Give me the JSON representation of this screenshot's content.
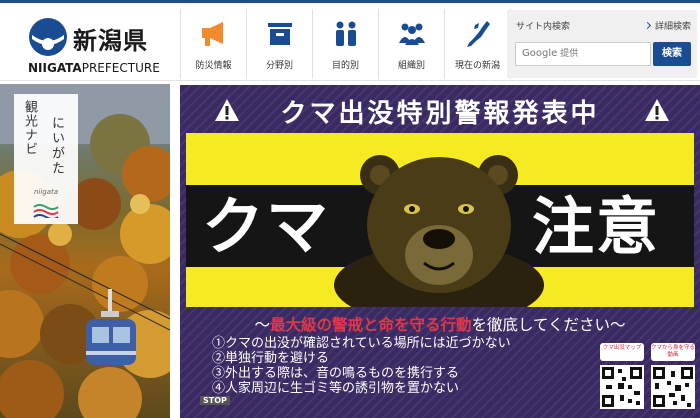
{
  "header": {
    "logo": {
      "name_ja": "新潟県",
      "name_en_bold": "NIIGATA",
      "name_en_light": "PREFECTURE"
    },
    "nav": [
      {
        "label": "防災情報",
        "icon": "megaphone-icon",
        "color": "#f1892d"
      },
      {
        "label": "分野別",
        "icon": "box-icon",
        "color": "#1a4c93"
      },
      {
        "label": "目的別",
        "icon": "people-icon",
        "color": "#1a4c93"
      },
      {
        "label": "組織別",
        "icon": "group-icon",
        "color": "#1a4c93"
      },
      {
        "label": "現在の新潟",
        "icon": "niigata-map-icon",
        "color": "#1a4c93"
      }
    ],
    "search": {
      "title": "サイト内検索",
      "advanced_label": "詳細検索",
      "placeholder_brand": "Google",
      "placeholder_text": "提供",
      "button_label": "検索"
    }
  },
  "tourism": {
    "col1": "観光ナビ",
    "col2": "にいがた",
    "sub": "niigata"
  },
  "banner": {
    "title": "クマ出没特別警報発表中",
    "big_left": "クマ",
    "big_right": "注意",
    "slogan_prefix": "〜",
    "slogan_red": "最大級の警戒と命を守る行動",
    "slogan_rest": "を徹底してください〜",
    "rules": [
      "①クマの出没が確認されている場所には近づかない",
      "②単独行動を避ける",
      "③外出する際は、音の鳴るものを携行する",
      "④人家周辺に生ゴミ等の誘引物を置かない"
    ],
    "mini_text": "",
    "stop_label": "STOP",
    "qr1_label": "クマ出没マップ",
    "qr2_label": "クマから身を守る動画",
    "colors": {
      "yellow": "#f6ea23",
      "purple": "#3a2a63",
      "red": "#e0384a"
    }
  }
}
